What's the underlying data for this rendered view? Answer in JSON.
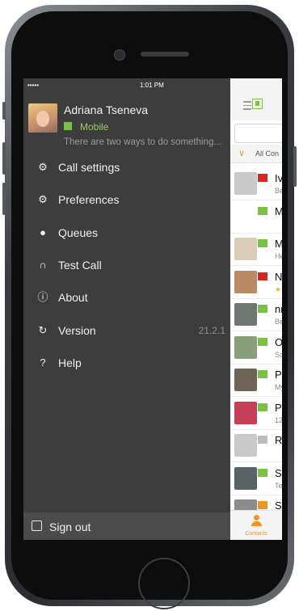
{
  "status_bar": {
    "signal": "•••••",
    "time": "1:01 PM"
  },
  "profile": {
    "name": "Adriana Tseneva",
    "status": "Mobile",
    "status_message": "There are two ways to do something...",
    "accent_color": "#7cc242"
  },
  "menu": [
    {
      "label": "Call settings",
      "icon": "gear-icon"
    },
    {
      "label": "Preferences",
      "icon": "gears-icon"
    },
    {
      "label": "Queues",
      "icon": "queue-user-icon"
    },
    {
      "label": "Test Call",
      "icon": "headset-icon"
    },
    {
      "label": "About",
      "icon": "info-icon"
    },
    {
      "label": "Version",
      "icon": "version-icon",
      "value": "21.2.1"
    },
    {
      "label": "Help",
      "icon": "question-icon"
    }
  ],
  "sign_out": {
    "label": "Sign out",
    "icon": "sign-out-icon"
  },
  "contacts_panel": {
    "filter_label": "All Con",
    "rows": [
      {
        "name": "Iv",
        "sub": "Be",
        "flag": "#d7261f",
        "avatar": "#c9c9c9"
      },
      {
        "name": "M",
        "sub": "",
        "flag": "#7cc242",
        "avatar": "#ffffff"
      },
      {
        "name": "M",
        "sub": "He",
        "flag": "#7cc242",
        "avatar": "#d9cdb8"
      },
      {
        "name": "N",
        "sub": "★",
        "flag": "#d7261f",
        "avatar": "#b98a63"
      },
      {
        "name": "nr",
        "sub": "Be",
        "flag": "#7cc242",
        "avatar": "#6f7570"
      },
      {
        "name": "O",
        "sub": "Sc",
        "flag": "#7cc242",
        "avatar": "#88a07a"
      },
      {
        "name": "Pa",
        "sub": "My",
        "flag": "#7cc242",
        "avatar": "#6e6456"
      },
      {
        "name": "Pa",
        "sub": "12",
        "flag": "#7cc242",
        "avatar": "#c53f57"
      },
      {
        "name": "R",
        "sub": "",
        "flag": "#bdbdbd",
        "avatar": "#c9c9c9"
      },
      {
        "name": "Sa",
        "sub": "Te",
        "flag": "#7cc242",
        "avatar": "#5a6266"
      },
      {
        "name": "S",
        "sub": "",
        "flag": "#f29421",
        "avatar": "#8c8c8c"
      }
    ],
    "tab_label": "Contacts",
    "tab_color": "#f29421"
  }
}
